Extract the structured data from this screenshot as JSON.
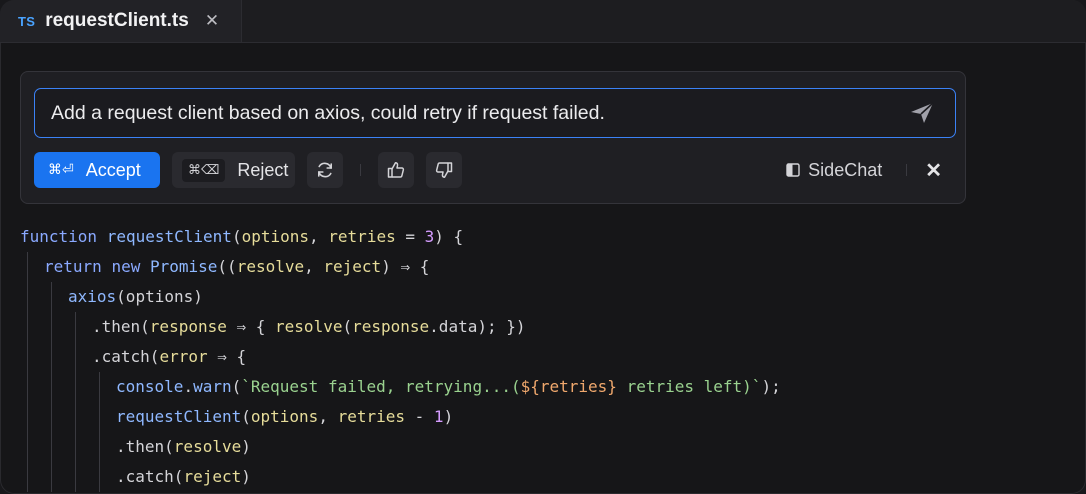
{
  "tab": {
    "lang": "TS",
    "filename": "requestClient.ts",
    "close": "✕"
  },
  "prompt": {
    "text": "Add a request client based on axios, could retry if request failed."
  },
  "actions": {
    "accept_kbd": "⌘⏎",
    "accept_label": "Accept",
    "reject_kbd": "⌘⌫",
    "reject_label": "Reject",
    "sidechat_label": "SideChat",
    "close": "✕"
  },
  "icons": [
    "send-icon",
    "refresh-icon",
    "thumbs-up-icon",
    "thumbs-down-icon",
    "sidechat-icon",
    "close-icon"
  ],
  "code": {
    "l1": [
      "function",
      " ",
      "requestClient",
      "(",
      "options",
      ", ",
      "retries",
      " = ",
      "3",
      ") {"
    ],
    "l2": [
      "return",
      " ",
      "new",
      " ",
      "Promise",
      "((",
      "resolve",
      ", ",
      "reject",
      ") ⇒ {"
    ],
    "l3": [
      "axios",
      "(options)"
    ],
    "l4": [
      ".then(",
      "response",
      " ⇒ { ",
      "resolve",
      "(",
      "response",
      ".data); })"
    ],
    "l5": [
      ".catch(",
      "error",
      " ⇒ {"
    ],
    "l6": [
      "console",
      ".",
      "warn",
      "(",
      "`Request failed, retrying...(",
      "${retries}",
      " retries left)`",
      ");"
    ],
    "l7": [
      "requestClient",
      "(",
      "options",
      ", ",
      "retries",
      " - ",
      "1",
      ")"
    ],
    "l8": [
      ".then(",
      "resolve",
      ")"
    ],
    "l9": [
      ".catch(",
      "reject",
      ")"
    ]
  }
}
